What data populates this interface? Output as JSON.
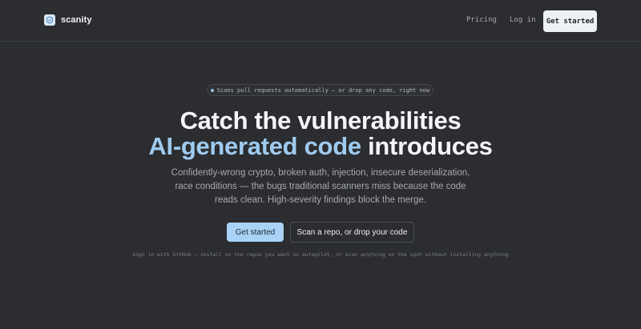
{
  "nav": {
    "brand": "scanity",
    "pricing": "Pricing",
    "login": "Log in",
    "cta": "Get started"
  },
  "hero": {
    "pill": "Scans pull requests automatically — or drop any code, right now",
    "headline_line1": "Catch the vulnerabilities",
    "headline_accent": "AI-generated code",
    "headline_rest": " introduces",
    "sub_line1": "Confidently-wrong crypto, broken auth, injection, insecure deserialization,",
    "sub_line2": "race conditions — the bugs traditional scanners miss because the code",
    "sub_line3": "reads clean. High-severity findings block the merge.",
    "primary_button": "Get started",
    "secondary_button": "Scan a repo, or drop your code",
    "footnote": "Sign in with GitHub — install on the repos you want on autopilot, or scan anything on the spot without installing anything"
  },
  "colors": {
    "background": "#2b2d30",
    "accent": "#9fcbf0",
    "primary_button": "#a9d3f6"
  },
  "icons": {
    "logo": "shield-scan-icon",
    "pill": "status-dot-icon"
  }
}
